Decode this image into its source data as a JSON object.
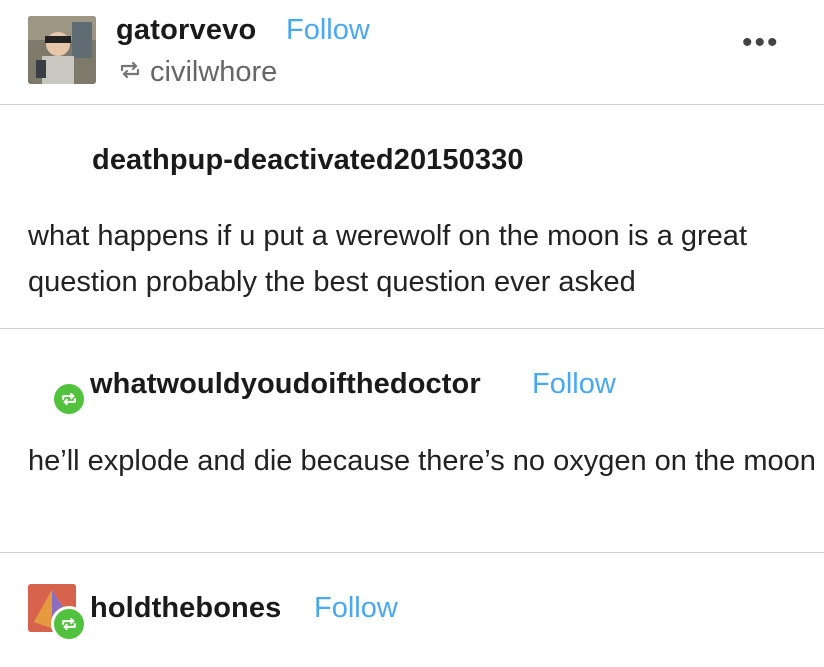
{
  "header": {
    "username": "gatorvevo",
    "follow_label": "Follow",
    "reblogged_from": "civilwhore",
    "more_label": "•••"
  },
  "posts": [
    {
      "author": "deathpup-deactivated20150330",
      "text": "what happens if u put a werewolf on the moon is a great question probably the best question ever asked"
    },
    {
      "author": "whatwouldyoudoifthedoctor",
      "follow_label": "Follow",
      "text": "he’ll explode and die because there’s no oxygen on the moon"
    },
    {
      "author": "holdthebones",
      "follow_label": "Follow"
    }
  ],
  "colors": {
    "follow": "#4aa8f0",
    "reblog_badge": "#52c13e",
    "divider": "#d0d0d0"
  },
  "icons": [
    "reblog-icon",
    "more-options-icon"
  ]
}
